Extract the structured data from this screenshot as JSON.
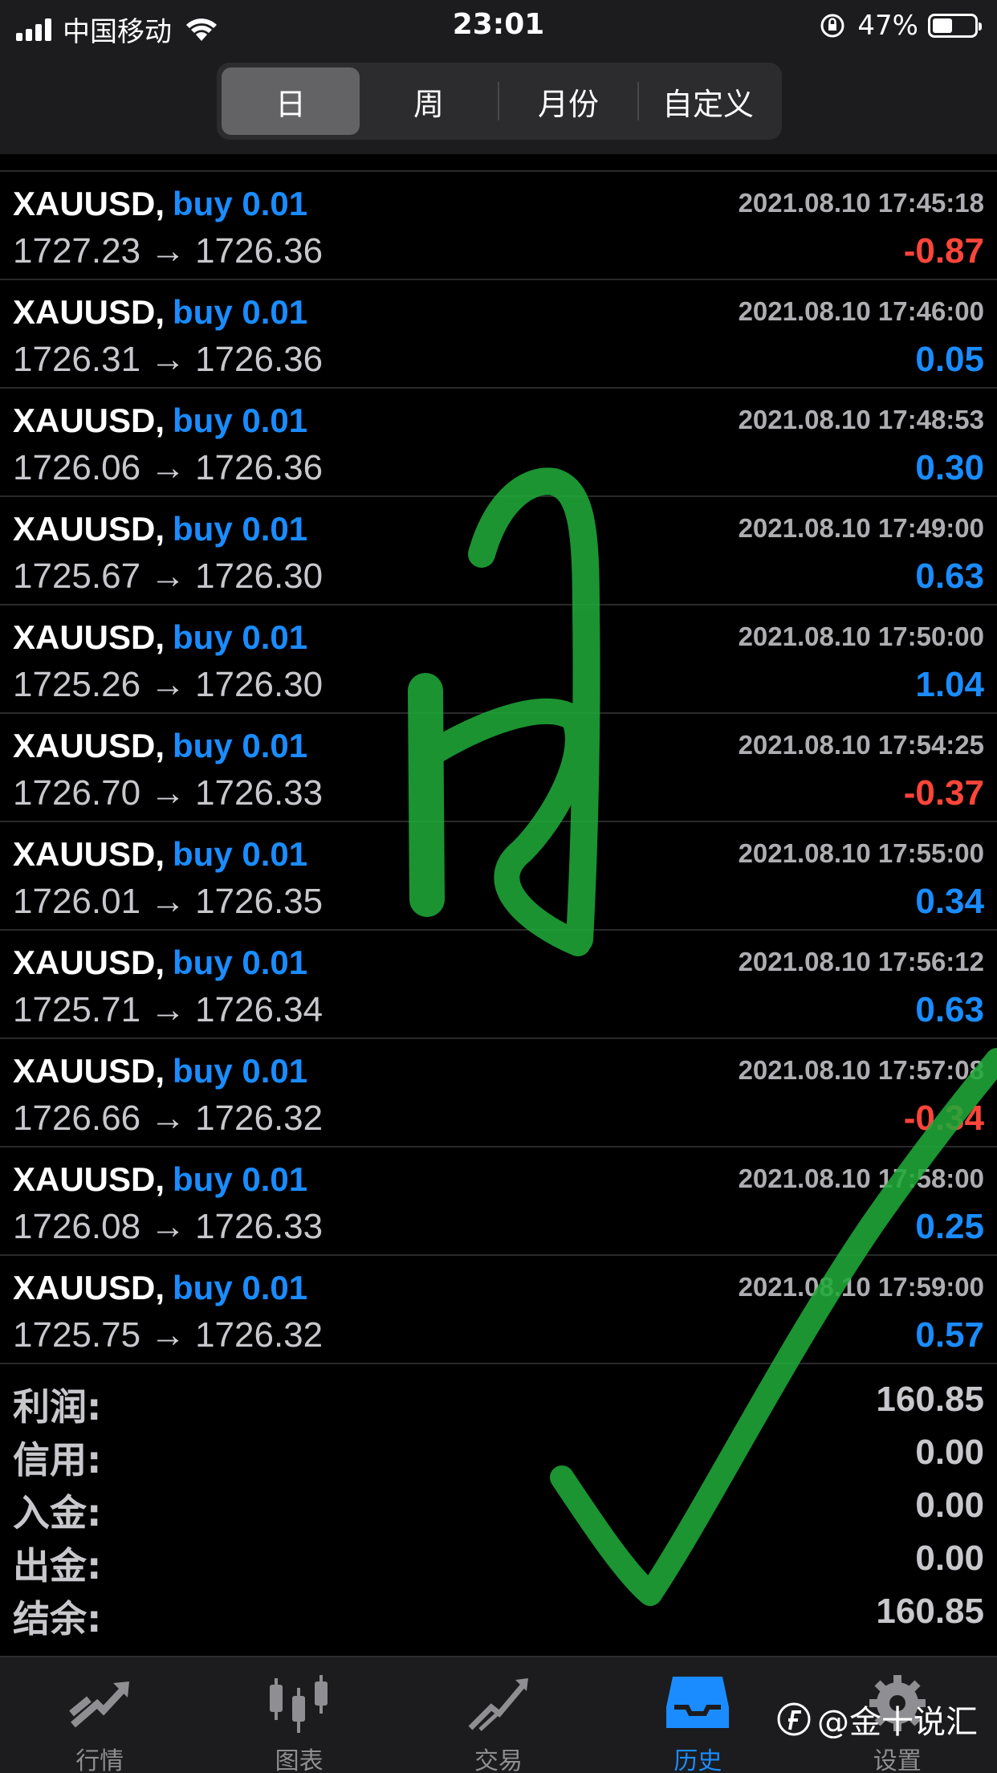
{
  "status_bar": {
    "carrier": "中国移动",
    "time": "23:01",
    "battery": "47%",
    "battery_level": 0.47
  },
  "segments": [
    {
      "label": "日",
      "active": true
    },
    {
      "label": "周",
      "active": false
    },
    {
      "label": "月份",
      "active": false
    },
    {
      "label": "自定义",
      "active": false
    }
  ],
  "trades": [
    {
      "symbol": "XAUUSD,",
      "action": "buy 0.01",
      "time": "2021.08.10 17:45:18",
      "open": "1727.23",
      "close": "1726.36",
      "profit": "-0.87",
      "negative": true
    },
    {
      "symbol": "XAUUSD,",
      "action": "buy 0.01",
      "time": "2021.08.10 17:46:00",
      "open": "1726.31",
      "close": "1726.36",
      "profit": "0.05",
      "negative": false
    },
    {
      "symbol": "XAUUSD,",
      "action": "buy 0.01",
      "time": "2021.08.10 17:48:53",
      "open": "1726.06",
      "close": "1726.36",
      "profit": "0.30",
      "negative": false
    },
    {
      "symbol": "XAUUSD,",
      "action": "buy 0.01",
      "time": "2021.08.10 17:49:00",
      "open": "1725.67",
      "close": "1726.30",
      "profit": "0.63",
      "negative": false
    },
    {
      "symbol": "XAUUSD,",
      "action": "buy 0.01",
      "time": "2021.08.10 17:50:00",
      "open": "1725.26",
      "close": "1726.30",
      "profit": "1.04",
      "negative": false
    },
    {
      "symbol": "XAUUSD,",
      "action": "buy 0.01",
      "time": "2021.08.10 17:54:25",
      "open": "1726.70",
      "close": "1726.33",
      "profit": "-0.37",
      "negative": true
    },
    {
      "symbol": "XAUUSD,",
      "action": "buy 0.01",
      "time": "2021.08.10 17:55:00",
      "open": "1726.01",
      "close": "1726.35",
      "profit": "0.34",
      "negative": false
    },
    {
      "symbol": "XAUUSD,",
      "action": "buy 0.01",
      "time": "2021.08.10 17:56:12",
      "open": "1725.71",
      "close": "1726.34",
      "profit": "0.63",
      "negative": false
    },
    {
      "symbol": "XAUUSD,",
      "action": "buy 0.01",
      "time": "2021.08.10 17:57:08",
      "open": "1726.66",
      "close": "1726.32",
      "profit": "-0.34",
      "negative": true
    },
    {
      "symbol": "XAUUSD,",
      "action": "buy 0.01",
      "time": "2021.08.10 17:58:00",
      "open": "1726.08",
      "close": "1726.33",
      "profit": "0.25",
      "negative": false
    },
    {
      "symbol": "XAUUSD,",
      "action": "buy 0.01",
      "time": "2021.08.10 17:59:00",
      "open": "1725.75",
      "close": "1726.32",
      "profit": "0.57",
      "negative": false
    }
  ],
  "arrow": "→",
  "summary": [
    {
      "label": "利润:",
      "value": "160.85"
    },
    {
      "label": "信用:",
      "value": "0.00"
    },
    {
      "label": "入金:",
      "value": "0.00"
    },
    {
      "label": "出金:",
      "value": "0.00"
    },
    {
      "label": "结余:",
      "value": "160.85"
    }
  ],
  "tabs": [
    {
      "label": "行情",
      "icon": "quotes-icon",
      "active": false
    },
    {
      "label": "图表",
      "icon": "candlestick-icon",
      "active": false
    },
    {
      "label": "交易",
      "icon": "trade-icon",
      "active": false
    },
    {
      "label": "历史",
      "icon": "history-tray-icon",
      "active": true
    },
    {
      "label": "设置",
      "icon": "gear-icon",
      "active": false
    }
  ],
  "watermark": "@金十说汇",
  "colors": {
    "positive": "#1a8cff",
    "negative": "#ff453a",
    "overlay_green": "#1fa838"
  }
}
